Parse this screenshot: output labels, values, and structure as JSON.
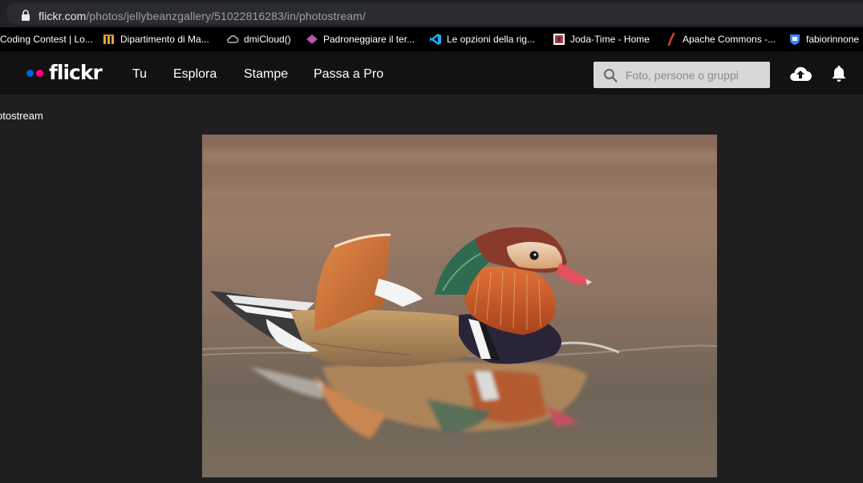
{
  "address_bar": {
    "host": "flickr.com",
    "path": "/photos/jellybeanzgallery/51022816283/in/photostream/"
  },
  "bookmarks": [
    {
      "label": "Coding Contest | Lo...",
      "icon": "contest-icon"
    },
    {
      "label": "Dipartimento di Ma...",
      "icon": "unimi-icon"
    },
    {
      "label": "dmiCloud()",
      "icon": "cloud-icon"
    },
    {
      "label": "Padroneggiare il ter...",
      "icon": "diamond-icon"
    },
    {
      "label": "Le opzioni della rig...",
      "icon": "vscode-icon"
    },
    {
      "label": "Joda-Time - Home",
      "icon": "joda-icon"
    },
    {
      "label": "Apache Commons -...",
      "icon": "feather-icon"
    },
    {
      "label": "fabiorinnone",
      "icon": "shield-icon"
    }
  ],
  "nav": {
    "logo_text": "flickr",
    "links": [
      "Tu",
      "Esplora",
      "Stampe",
      "Passa a Pro"
    ],
    "search_placeholder": "Foto, persone o gruppi"
  },
  "breadcrumb": "otostream",
  "photo": {
    "subject": "mandarin duck on water"
  },
  "colors": {
    "nav_bg": "#121212",
    "page_bg": "#1f1f1f",
    "flickr_blue": "#0063dc",
    "flickr_pink": "#ff0084"
  }
}
